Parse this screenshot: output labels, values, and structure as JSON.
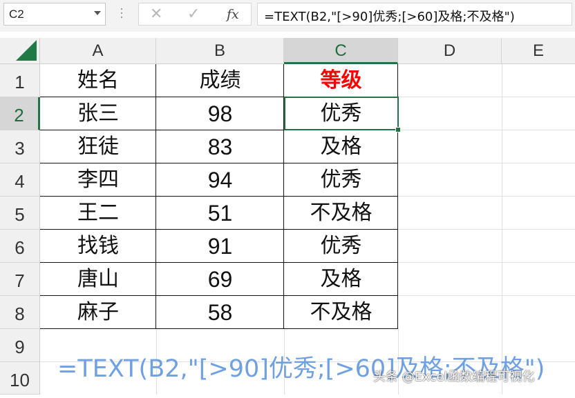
{
  "formula_bar": {
    "name_box": "C2",
    "fx_label": "fx",
    "formula": "=TEXT(B2,\"[>90]优秀;[>60]及格;不及格\")"
  },
  "columns": [
    "A",
    "B",
    "C",
    "D",
    "E"
  ],
  "rows": [
    "1",
    "2",
    "3",
    "4",
    "5",
    "6",
    "7",
    "8",
    "9",
    "10"
  ],
  "table": {
    "headers": [
      "姓名",
      "成绩",
      "等级"
    ],
    "rows": [
      [
        "张三",
        "98",
        "优秀"
      ],
      [
        "狂徒",
        "83",
        "及格"
      ],
      [
        "李四",
        "94",
        "优秀"
      ],
      [
        "王二",
        "51",
        "不及格"
      ],
      [
        "找钱",
        "91",
        "优秀"
      ],
      [
        "唐山",
        "69",
        "及格"
      ],
      [
        "麻子",
        "58",
        "不及格"
      ]
    ]
  },
  "overlay_formula": "=TEXT(B2,\"[>90]优秀;[>60]及格;不及格\")",
  "watermark": "头条 @Excel函数编程可视化",
  "colors": {
    "accent": "#217346",
    "grade_header": "#ff0000",
    "overlay_text": "#6fa0e0"
  }
}
